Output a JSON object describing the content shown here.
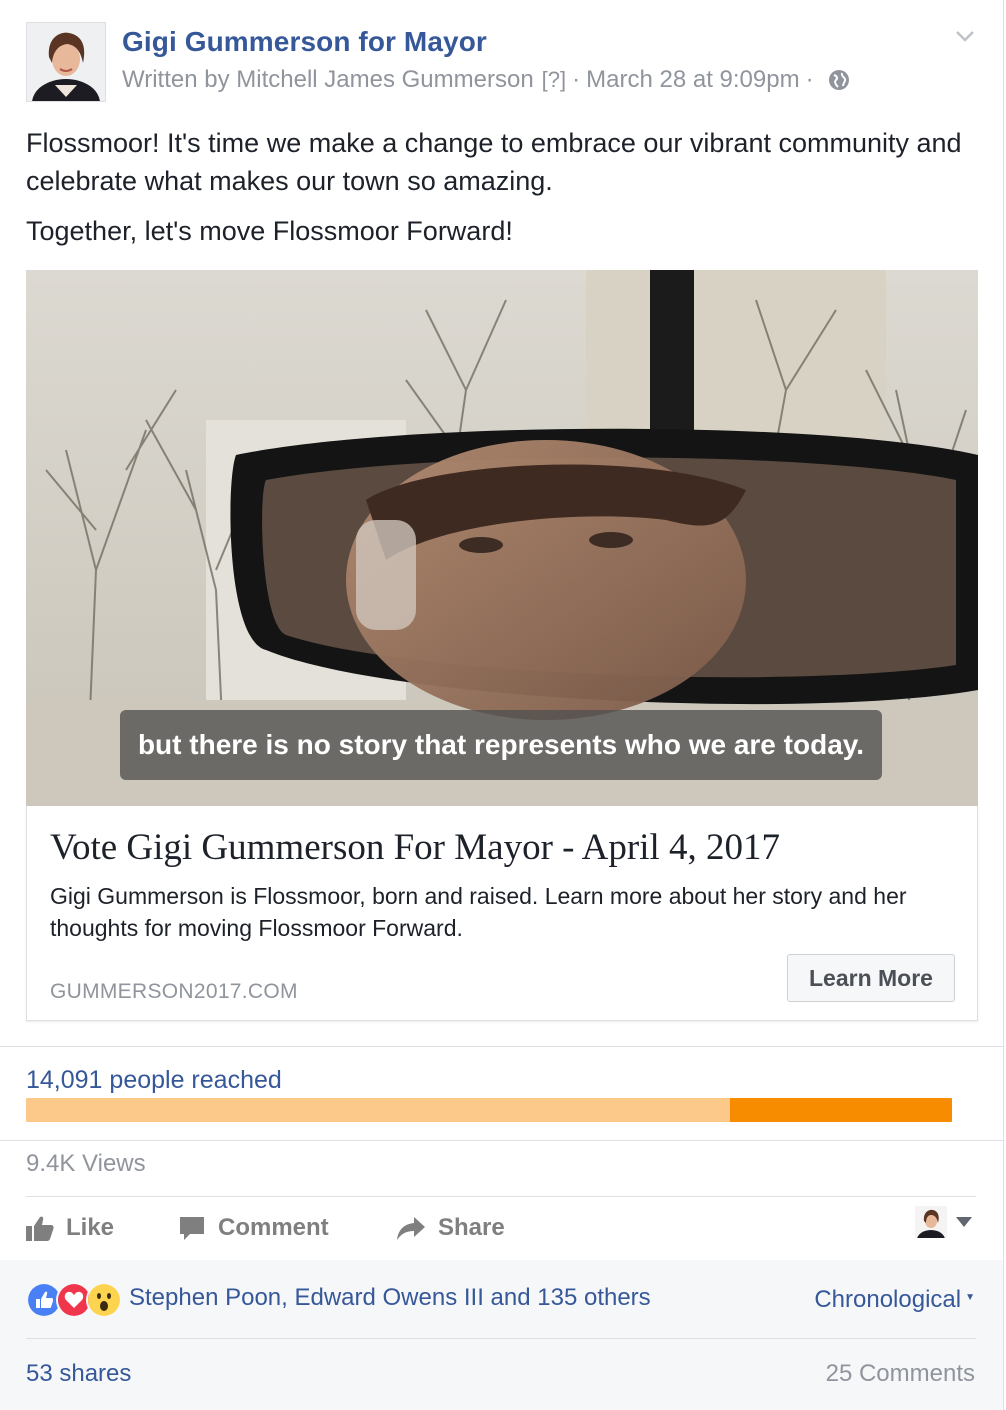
{
  "header": {
    "page_name": "Gigi Gummerson for Mayor",
    "written_by": "Written by Mitchell James Gummerson",
    "help_marker": "[?]",
    "separator": "·",
    "timestamp": "March 28 at 9:09pm",
    "privacy_icon": "globe-icon",
    "menu_icon": "chevron-down-icon"
  },
  "post": {
    "text_line1": "Flossmoor! It's time we make a change to embrace our vibrant community and celebrate what makes our town so amazing.",
    "text_line2": "Together, let's move Flossmoor Forward!"
  },
  "video": {
    "caption": "but there is no story that represents who we are today."
  },
  "link_card": {
    "title": "Vote Gigi Gummerson For Mayor - April 4, 2017",
    "description": "Gigi Gummerson is Flossmoor, born and raised. Learn more about her story and her thoughts for moving Flossmoor Forward.",
    "domain": "GUMMERSON2017.COM",
    "cta_label": "Learn More"
  },
  "insights": {
    "reached": "14,091 people reached",
    "paid_fraction": 0.24,
    "views": "9.4K Views",
    "colors": {
      "organic": "#fdc98a",
      "paid": "#f78c00"
    }
  },
  "actions": {
    "like": "Like",
    "comment": "Comment",
    "share": "Share"
  },
  "reactions": {
    "icons": [
      "like-icon",
      "love-icon",
      "wow-icon"
    ],
    "summary": "Stephen Poon, Edward Owens III and 135 others",
    "sort_label": "Chronological",
    "shares": "53 shares",
    "comments": "25 Comments"
  },
  "colors": {
    "link": "#365899",
    "meta": "#90949c",
    "text": "#1d2129"
  }
}
